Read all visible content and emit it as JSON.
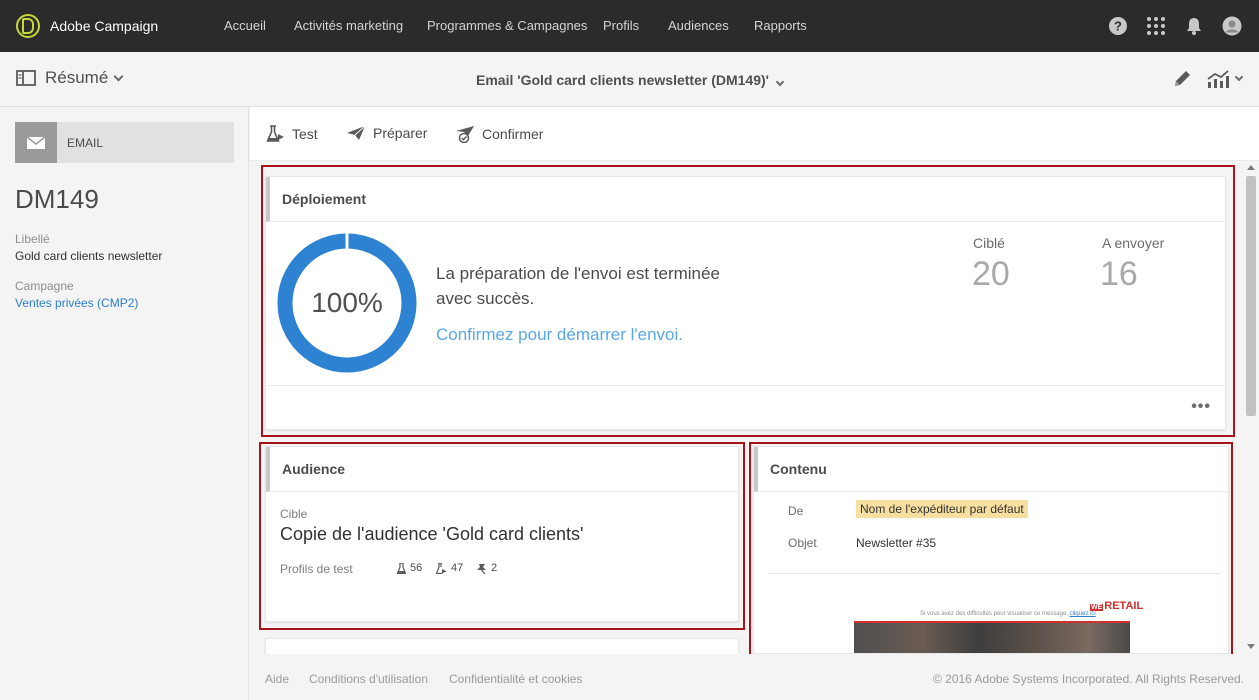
{
  "app": {
    "name": "Adobe Campaign"
  },
  "nav": {
    "items": [
      "Accueil",
      "Activités marketing",
      "Programmes & Campagnes",
      "Profils",
      "Audiences",
      "Rapports"
    ],
    "icons": [
      "help-icon",
      "apps-grid-icon",
      "notifications-bell-icon",
      "user-avatar-icon"
    ]
  },
  "subheader": {
    "summary_label": "Résumé",
    "title": "Email 'Gold card clients newsletter (DM149)'"
  },
  "sidebar": {
    "type_label": "EMAIL",
    "code": "DM149",
    "label_caption": "Libellé",
    "label_value": "Gold card clients newsletter",
    "campaign_caption": "Campagne",
    "campaign_value": "Ventes privées (CMP2)"
  },
  "toolbar": {
    "test_label": "Test",
    "prepare_label": "Préparer",
    "confirm_label": "Confirmer"
  },
  "deployment": {
    "title": "Déploiement",
    "progress_percent": 100,
    "progress_text": "100%",
    "status_message": "La préparation de l'envoi est terminée avec succès.",
    "confirm_link": "Confirmez pour démarrer l'envoi.",
    "targeted_label": "Ciblé",
    "targeted_value": "20",
    "to_send_label": "A envoyer",
    "to_send_value": "16",
    "more_label": "•••"
  },
  "audience": {
    "title": "Audience",
    "target_caption": "Cible",
    "target_value": "Copie de l'audience 'Gold card clients'",
    "test_profiles_caption": "Profils de test",
    "counts": [
      "56",
      "47",
      "2"
    ]
  },
  "content": {
    "title": "Contenu",
    "from_caption": "De",
    "from_value": "Nom de l'expéditeur par défaut",
    "subject_caption": "Objet",
    "subject_value": "Newsletter #35",
    "preview_note": "Si vous avez des difficultés pour visualiser ce message,",
    "preview_link": "cliquez ici",
    "preview_logo_prefix": "WE",
    "preview_logo": "RETAIL"
  },
  "footer": {
    "links": [
      "Aide",
      "Conditions d'utilisation",
      "Confidentialité et cookies"
    ],
    "copyright": "© 2016 Adobe Systems Incorporated. All Rights Reserved."
  },
  "colors": {
    "nav_bg": "#2b2b2b",
    "progress_ring": "#2d82d2",
    "link": "#2d7dd2",
    "highlight_frame": "#a8121b",
    "sender_chip": "#f7dfa0"
  }
}
